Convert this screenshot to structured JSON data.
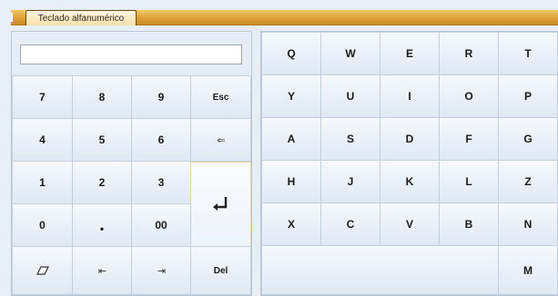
{
  "window": {
    "title": "Teclado alfanumérico"
  },
  "display": {
    "value": "",
    "placeholder": ""
  },
  "numpad": {
    "row1": [
      "7",
      "8",
      "9",
      "Esc"
    ],
    "row2": [
      "4",
      "5",
      "6"
    ],
    "row3": [
      "1",
      "2",
      "3"
    ],
    "row4": [
      "0",
      "•",
      "00"
    ],
    "row5_del": "Del",
    "icons": {
      "backspace": "arrow-left-icon",
      "enter": "enter-icon",
      "clear": "eraser-icon",
      "cursor_left": "cursor-left-icon",
      "cursor_right": "cursor-right-icon"
    },
    "glyphs": {
      "backspace": "⇐",
      "cursor_left": "⇤",
      "cursor_right": "⇥"
    }
  },
  "letters": {
    "row1": [
      "Q",
      "W",
      "E",
      "R",
      "T"
    ],
    "row2": [
      "Y",
      "U",
      "I",
      "O",
      "P"
    ],
    "row3": [
      "A",
      "S",
      "D",
      "F",
      "G"
    ],
    "row4": [
      "H",
      "J",
      "K",
      "L",
      "Z"
    ],
    "row5": [
      "X",
      "C",
      "V",
      "B",
      "N"
    ],
    "row6_last": "M"
  },
  "colors": {
    "title_bar": "#dba037",
    "key_face": "#eef3f9",
    "panel": "#dbe6f2",
    "enter_border": "#e8d39a"
  }
}
